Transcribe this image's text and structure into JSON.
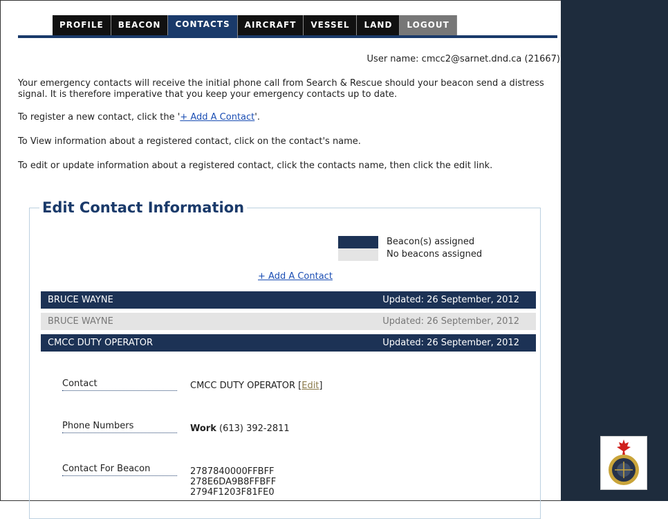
{
  "nav": {
    "tabs": [
      "PROFILE",
      "BEACON",
      "CONTACTS",
      "AIRCRAFT",
      "VESSEL",
      "LAND",
      "LOGOUT"
    ],
    "active": "CONTACTS"
  },
  "user": {
    "label": "User name: cmcc2@sarnet.dnd.ca (21667)"
  },
  "intro": {
    "p1": "Your emergency contacts will receive the initial phone call from Search & Rescue should your beacon send a distress signal. It is therefore imperative that you keep your emergency contacts up to date.",
    "p2_before": "To register a new contact, click the '",
    "p2_link": "+ Add A Contact",
    "p2_after": "'.",
    "p3": "To View information about a registered contact, click on the contact's name.",
    "p4": "To edit or update information about a registered contact, click the contacts name, then click the edit link."
  },
  "box": {
    "title": "Edit Contact Information",
    "legend_assigned": "Beacon(s) assigned",
    "legend_none": "No beacons assigned",
    "add_link": "+ Add A Contact"
  },
  "contacts": [
    {
      "name": "BRUCE WAYNE",
      "updated": "Updated: 26 September, 2012",
      "assigned": true
    },
    {
      "name": "BRUCE WAYNE",
      "updated": "Updated: 26 September, 2012",
      "assigned": false
    },
    {
      "name": "CMCC DUTY OPERATOR",
      "updated": "Updated: 26 September, 2012",
      "assigned": true
    }
  ],
  "detail": {
    "contact_label": "Contact",
    "contact_value": "CMCC DUTY OPERATOR",
    "edit_open": "[",
    "edit_label": "Edit",
    "edit_close": "]",
    "phone_label": "Phone Numbers",
    "phone_type": "Work",
    "phone_number": "(613) 392-2811",
    "beacon_label": "Contact For Beacon",
    "beacons": [
      "2787840000FFBFF",
      "278E6DA9B8FFBFF",
      "2794F1203F81FE0"
    ]
  },
  "colors": {
    "navy": "#1c3255",
    "sidebar": "#1e2c3d",
    "light_row": "#e4e4e4",
    "link": "#1a4db3"
  },
  "icons": {
    "emblem": "canada-sar-emblem-icon"
  }
}
